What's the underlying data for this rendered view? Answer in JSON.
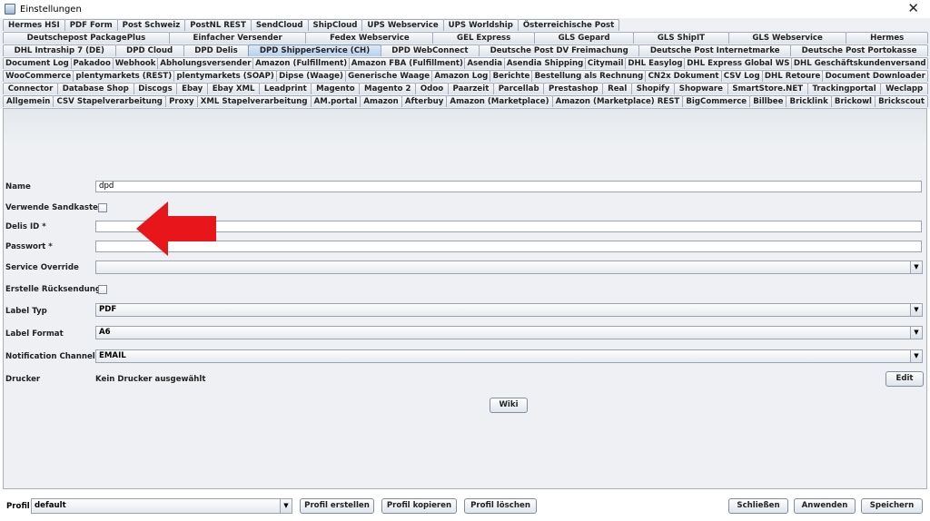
{
  "window": {
    "title": "Einstellungen",
    "close_glyph": "✕"
  },
  "tab_rows": [
    [
      "Hermes HSI",
      "PDF Form",
      "Post Schweiz",
      "PostNL REST",
      "SendCloud",
      "ShipCloud",
      "UPS Webservice",
      "UPS Worldship",
      "Österreichische Post"
    ],
    [
      "Deutschepost PackagePlus",
      "Einfacher Versender",
      "Fedex Webservice",
      "GEL Express",
      "GLS Gepard",
      "GLS ShipIT",
      "GLS Webservice",
      "Hermes"
    ],
    [
      "DHL Intraship 7 (DE)",
      "DPD Cloud",
      "DPD Delis",
      "DPD ShipperService (CH)",
      "DPD WebConnect",
      "Deutsche Post DV Freimachung",
      "Deutsche Post Internetmarke",
      "Deutsche Post Portokasse"
    ],
    [
      "Document Log",
      "Pakadoo",
      "Webhook",
      "Abholungsversender",
      "Amazon (Fulfillment)",
      "Amazon FBA (Fulfillment)",
      "Asendia",
      "Asendia Shipping",
      "Citymail",
      "DHL Easylog",
      "DHL Express Global WS",
      "DHL Geschäftskundenversand"
    ],
    [
      "WooCommerce",
      "plentymarkets (REST)",
      "plentymarkets (SOAP)",
      "Dipse (Waage)",
      "Generische Waage",
      "Amazon Log",
      "Berichte",
      "Bestellung als Rechnung",
      "CN2x Dokument",
      "CSV Log",
      "DHL Retoure",
      "Document Downloader"
    ],
    [
      "Connector",
      "Database Shop",
      "Discogs",
      "Ebay",
      "Ebay XML",
      "Leadprint",
      "Magento",
      "Magento 2",
      "Odoo",
      "Paarzeit",
      "Parcellab",
      "Prestashop",
      "Real",
      "Shopify",
      "Shopware",
      "SmartStore.NET",
      "Trackingportal",
      "Weclapp"
    ],
    [
      "Allgemein",
      "CSV Stapelverarbeitung",
      "Proxy",
      "XML Stapelverarbeitung",
      "AM.portal",
      "Amazon",
      "Afterbuy",
      "Amazon (Marketplace)",
      "Amazon (Marketplace) REST",
      "BigCommerce",
      "Billbee",
      "Bricklink",
      "Brickowl",
      "Brickscout"
    ]
  ],
  "selected_tab": "DPD ShipperService (CH)",
  "form": {
    "name_label": "Name",
    "name_value": "dpd",
    "sandbox_label": "Verwende Sandkasten",
    "delis_label": "Delis ID *",
    "delis_value": "",
    "password_label": "Passwort *",
    "password_value": "",
    "service_override_label": "Service Override",
    "service_override_value": "",
    "return_label": "Erstelle Rücksendung",
    "label_type_label": "Label Typ",
    "label_type_value": "PDF",
    "label_format_label": "Label Format",
    "label_format_value": "A6",
    "notification_label": "Notification Channel",
    "notification_value": "EMAIL",
    "printer_label": "Drucker",
    "printer_value": "Kein Drucker ausgewählt",
    "edit_button": "Edit",
    "wiki_button": "Wiki"
  },
  "annotation": {
    "arrow_color": "#e8161b",
    "icon": "red-arrow-left"
  },
  "bottom": {
    "profile_label": "Profil",
    "profile_value": "default",
    "create_profile": "Profil erstellen",
    "copy_profile": "Profil kopieren",
    "delete_profile": "Profil löschen",
    "close": "Schließen",
    "apply": "Anwenden",
    "save": "Speichern"
  },
  "dropdown_glyph": "▼"
}
